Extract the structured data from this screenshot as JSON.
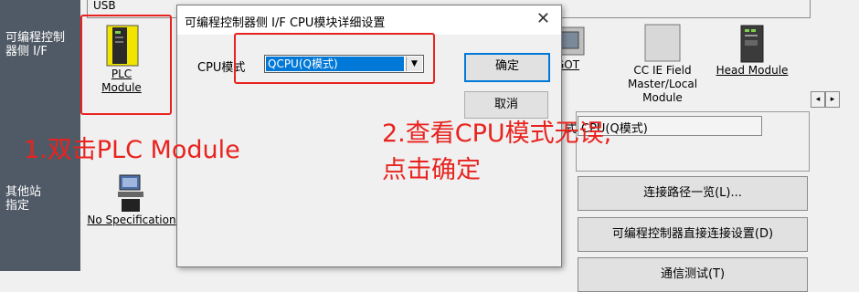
{
  "sidebar": {
    "plc_side_if": "可编程控制\n器侧 I/F",
    "other_station": "其他站\n指定"
  },
  "usb_label": "USB",
  "icons": {
    "plc_module_line1": "PLC",
    "plc_module_line2": "Module",
    "got": "GOT",
    "cc_ie_line1": "CC IE Field",
    "cc_ie_line2": "Master/Local",
    "cc_ie_line3": "Module",
    "head_module": "Head Module",
    "no_spec": "No Specification"
  },
  "right_panel": {
    "cpu_mode_label": "式",
    "cpu_mode_value": "CPU(Q模式)",
    "conn_path_list": "连接路径一览(L)...",
    "direct_conn": "可编程控制器直接连接设置(D)",
    "comm_test": "通信测试(T)"
  },
  "dialog": {
    "title": "可编程控制器侧 I/F CPU模块详细设置",
    "close_symbol": "✕",
    "cpu_mode_label": "CPU模式",
    "cpu_mode_value": "QCPU(Q模式)",
    "ok": "确定",
    "cancel": "取消"
  },
  "annotations": {
    "step1": "1.双击PLC Module",
    "step2_line1": "2.查看CPU模式无误,",
    "step2_line2": "点击确定",
    "color": "#e8231f"
  },
  "scroll": {
    "left": "◂",
    "right": "▸"
  }
}
